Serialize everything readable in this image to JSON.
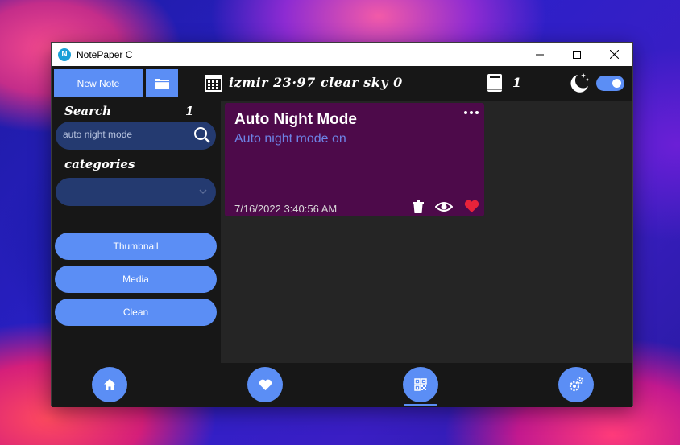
{
  "window": {
    "title": "NotePaper C",
    "logo_letter": "N"
  },
  "toolbar": {
    "new_note_label": "New Note",
    "weather": "izmir 23·97 clear sky 0",
    "book_count": "1"
  },
  "sidebar": {
    "search_label": "Search",
    "search_count": "1",
    "search_value": "auto night mode",
    "categories_label": "categories",
    "buttons": [
      "Thumbnail",
      "Media",
      "Clean"
    ]
  },
  "note": {
    "title": "Auto Night Mode",
    "body": "Auto night mode on",
    "date": "7/16/2022 3:40:56 AM",
    "favorite": true
  },
  "settings": {
    "night_mode_toggle": true
  },
  "colors": {
    "accent": "#5b8ef5",
    "note_bg": "#4d0a4a",
    "heart": "#e8233a"
  }
}
